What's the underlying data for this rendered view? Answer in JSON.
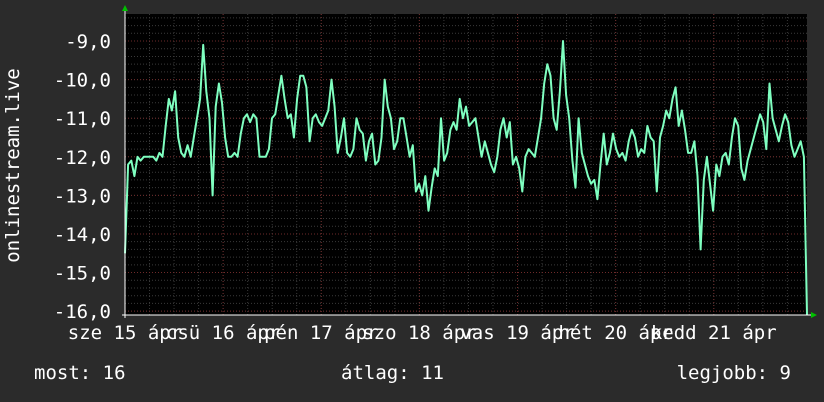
{
  "colors": {
    "background": "#2b2b2b",
    "plot_background": "#000000",
    "line": "#7fffc0",
    "grid_minor": "#3a3a3a",
    "grid_major": "#6e2a2a",
    "text": "#ffffff",
    "axis_arrow": "#00c000"
  },
  "chart_data": {
    "type": "line",
    "ylabel": "onlinestream.live",
    "ylim": [
      -16.1,
      -8.3
    ],
    "y_ticks": [
      {
        "value": -9,
        "label": "-9,0"
      },
      {
        "value": -10,
        "label": "-10,0"
      },
      {
        "value": -11,
        "label": "-11,0"
      },
      {
        "value": -12,
        "label": "-12,0"
      },
      {
        "value": -13,
        "label": "-13,0"
      },
      {
        "value": -14,
        "label": "-14,0"
      },
      {
        "value": -15,
        "label": "-15,0"
      },
      {
        "value": -16,
        "label": "-16,0"
      }
    ],
    "xlim": [
      0,
      6.95
    ],
    "x_ticks": [
      {
        "value": 0,
        "label": "sze 15 ápr"
      },
      {
        "value": 1,
        "label": "csü 16 ápr"
      },
      {
        "value": 2,
        "label": "pén 17 ápr"
      },
      {
        "value": 3,
        "label": "szo 18 ápr"
      },
      {
        "value": 4,
        "label": "vas 19 ápr"
      },
      {
        "value": 5,
        "label": "hét 20 ápr"
      },
      {
        "value": 6,
        "label": "kedd 21 ápr"
      }
    ],
    "series": [
      {
        "values": [
          -14.5,
          -12.2,
          -12.1,
          -12.5,
          -12.0,
          -12.1,
          -12.0,
          -12.0,
          -12.0,
          -12.0,
          -12.1,
          -11.9,
          -12.0,
          -11.2,
          -10.5,
          -10.8,
          -10.3,
          -11.5,
          -11.9,
          -12.0,
          -11.7,
          -12.0,
          -11.5,
          -11.0,
          -10.5,
          -9.1,
          -10.3,
          -11.0,
          -13.0,
          -10.7,
          -10.1,
          -10.6,
          -11.5,
          -12.0,
          -12.0,
          -11.9,
          -12.0,
          -11.4,
          -11.0,
          -10.9,
          -11.1,
          -10.9,
          -11.0,
          -12.0,
          -12.0,
          -12.0,
          -11.8,
          -11.0,
          -10.9,
          -10.4,
          -9.9,
          -10.5,
          -11.0,
          -10.9,
          -11.5,
          -10.5,
          -9.9,
          -9.9,
          -10.2,
          -11.6,
          -11.0,
          -10.9,
          -11.1,
          -11.2,
          -11.0,
          -10.8,
          -10.0,
          -10.7,
          -11.9,
          -11.5,
          -11.0,
          -11.9,
          -12.0,
          -11.8,
          -11.0,
          -11.3,
          -11.4,
          -12.1,
          -11.6,
          -11.4,
          -12.2,
          -12.1,
          -11.5,
          -10.0,
          -10.7,
          -11.0,
          -11.8,
          -11.6,
          -11.0,
          -11.0,
          -11.5,
          -12.0,
          -11.7,
          -12.9,
          -12.7,
          -13.0,
          -12.5,
          -13.4,
          -12.8,
          -12.3,
          -12.5,
          -11.0,
          -12.1,
          -11.9,
          -11.3,
          -11.1,
          -11.3,
          -10.5,
          -11.0,
          -10.7,
          -11.2,
          -11.1,
          -11.0,
          -11.5,
          -12.0,
          -11.6,
          -11.9,
          -12.2,
          -12.4,
          -12.0,
          -11.3,
          -11.0,
          -11.5,
          -11.1,
          -12.2,
          -12.0,
          -12.3,
          -12.9,
          -12.0,
          -11.8,
          -11.9,
          -12.0,
          -11.5,
          -11.0,
          -10.1,
          -9.6,
          -9.9,
          -11.0,
          -11.3,
          -10.3,
          -9.0,
          -10.4,
          -11.0,
          -12.1,
          -12.8,
          -11.0,
          -11.9,
          -12.2,
          -12.5,
          -12.7,
          -12.6,
          -13.1,
          -12.2,
          -11.4,
          -12.2,
          -11.9,
          -11.4,
          -11.8,
          -12.0,
          -11.9,
          -12.1,
          -11.6,
          -11.3,
          -11.5,
          -12.0,
          -11.8,
          -11.9,
          -11.2,
          -11.5,
          -11.6,
          -12.9,
          -11.5,
          -11.2,
          -10.8,
          -11.0,
          -10.5,
          -10.2,
          -11.2,
          -10.8,
          -11.3,
          -11.9,
          -11.9,
          -11.6,
          -12.5,
          -14.4,
          -12.6,
          -12.0,
          -12.7,
          -13.4,
          -12.2,
          -12.5,
          -12.0,
          -11.9,
          -12.2,
          -11.5,
          -11.0,
          -11.2,
          -12.3,
          -12.6,
          -12.1,
          -11.8,
          -11.5,
          -11.2,
          -10.9,
          -11.1,
          -11.8,
          -10.1,
          -11.0,
          -11.3,
          -11.6,
          -11.2,
          -10.9,
          -11.1,
          -11.7,
          -12.0,
          -11.8,
          -11.6,
          -12.0,
          -16.1
        ]
      }
    ]
  },
  "stats": {
    "now": "most: 16",
    "avg": "átlag: 11",
    "best": "legjobb: 9"
  }
}
